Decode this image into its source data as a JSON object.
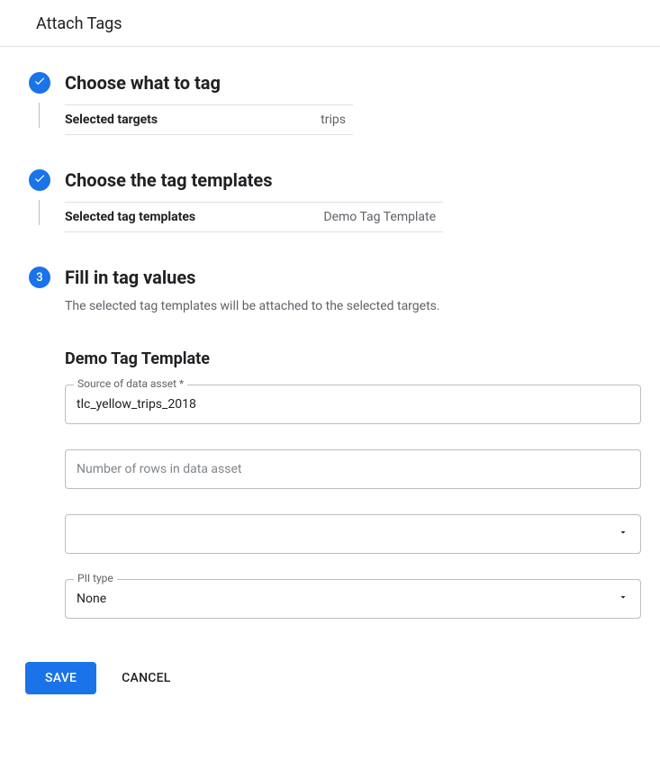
{
  "header": {
    "title": "Attach Tags"
  },
  "steps": {
    "one": {
      "title": "Choose what to tag",
      "summary_label": "Selected targets",
      "summary_value": "trips"
    },
    "two": {
      "title": "Choose the tag templates",
      "summary_label": "Selected tag templates",
      "summary_value": "Demo Tag Template"
    },
    "three": {
      "number": "3",
      "title": "Fill in tag values",
      "description": "The selected tag templates will be attached to the selected targets."
    }
  },
  "form": {
    "section_heading": "Demo Tag Template",
    "source": {
      "label": "Source of data asset *",
      "value": "tlc_yellow_trips_2018"
    },
    "rows": {
      "placeholder": "Number of rows in data asset",
      "value": ""
    },
    "unnamed_select": {
      "value": ""
    },
    "pii": {
      "label": "PII type",
      "value": "None"
    }
  },
  "footer": {
    "save": "SAVE",
    "cancel": "CANCEL"
  }
}
